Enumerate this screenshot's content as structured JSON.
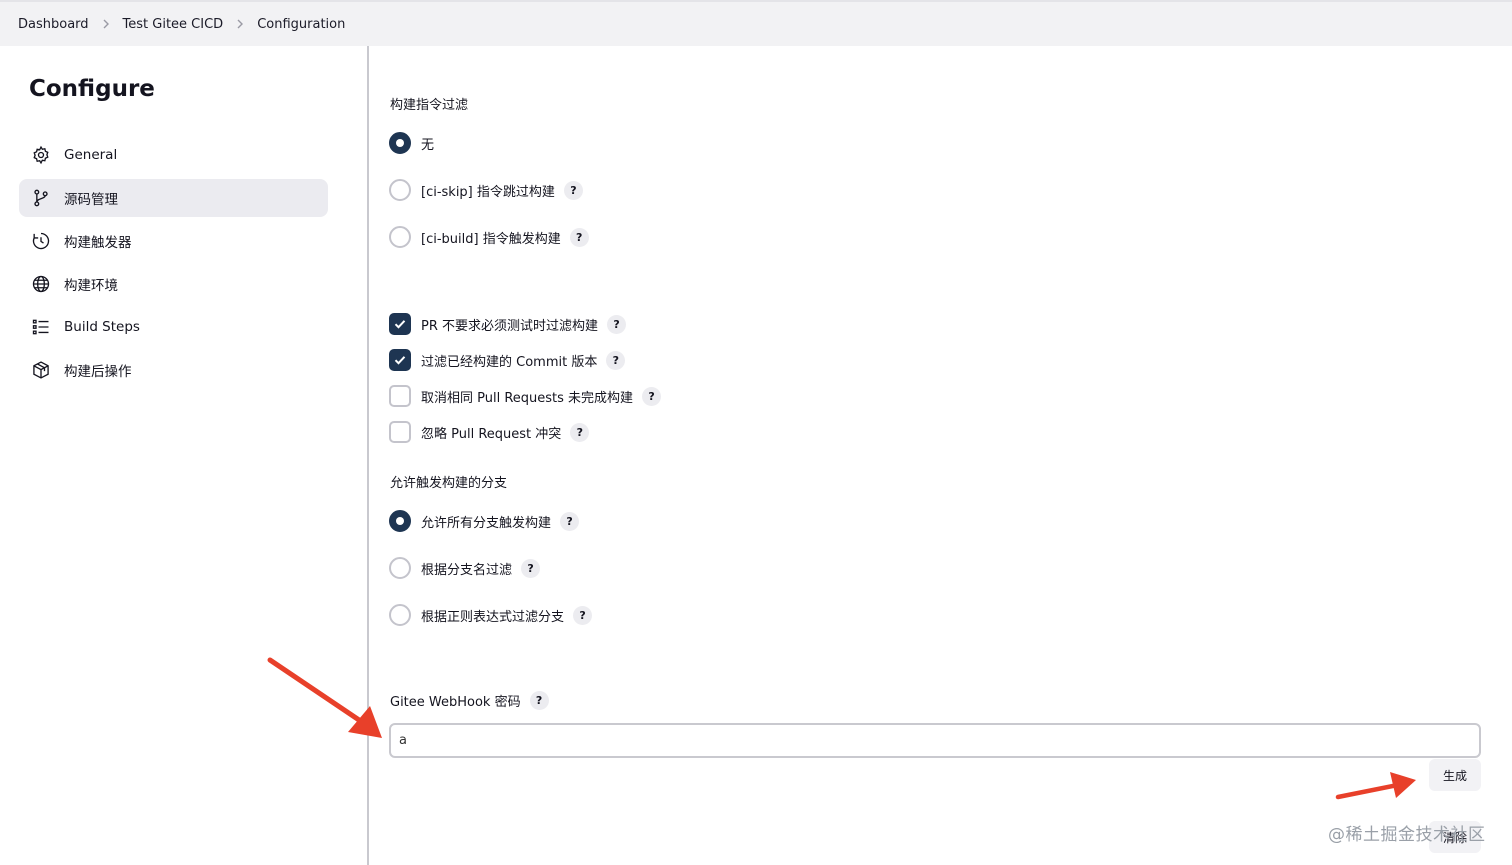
{
  "breadcrumb": {
    "items": [
      "Dashboard",
      "Test Gitee CICD",
      "Configuration"
    ]
  },
  "sidebar": {
    "title": "Configure",
    "items": [
      {
        "label": "General",
        "icon": "gear-icon"
      },
      {
        "label": "源码管理",
        "icon": "git-branch-icon",
        "active": true
      },
      {
        "label": "构建触发器",
        "icon": "clock-icon"
      },
      {
        "label": "构建环境",
        "icon": "globe-icon"
      },
      {
        "label": "Build Steps",
        "icon": "list-icon"
      },
      {
        "label": "构建后操作",
        "icon": "package-icon"
      }
    ]
  },
  "main": {
    "command_filter": {
      "label": "构建指令过滤",
      "options": [
        {
          "label": "无",
          "selected": true
        },
        {
          "label": "[ci-skip] 指令跳过构建",
          "selected": false
        },
        {
          "label": "[ci-build] 指令触发构建",
          "selected": false
        }
      ]
    },
    "pr_options": [
      {
        "label": "PR 不要求必须测试时过滤构建",
        "checked": true
      },
      {
        "label": "过滤已经构建的 Commit 版本",
        "checked": true
      },
      {
        "label": "取消相同 Pull Requests 未完成构建",
        "checked": false
      },
      {
        "label": "忽略 Pull Request 冲突",
        "checked": false
      }
    ],
    "branch_filter": {
      "label": "允许触发构建的分支",
      "options": [
        {
          "label": "允许所有分支触发构建",
          "selected": true
        },
        {
          "label": "根据分支名过滤",
          "selected": false
        },
        {
          "label": "根据正则表达式过滤分支",
          "selected": false
        }
      ]
    },
    "webhook": {
      "label": "Gitee WebHook 密码",
      "value": "a",
      "generate_label": "生成",
      "clear_label": "清除"
    },
    "help_glyph": "?"
  },
  "watermark": "@稀土掘金技术社区",
  "colors": {
    "accent": "#1e3552",
    "arrow": "#e8402a",
    "active_bg": "#ebebf0"
  }
}
